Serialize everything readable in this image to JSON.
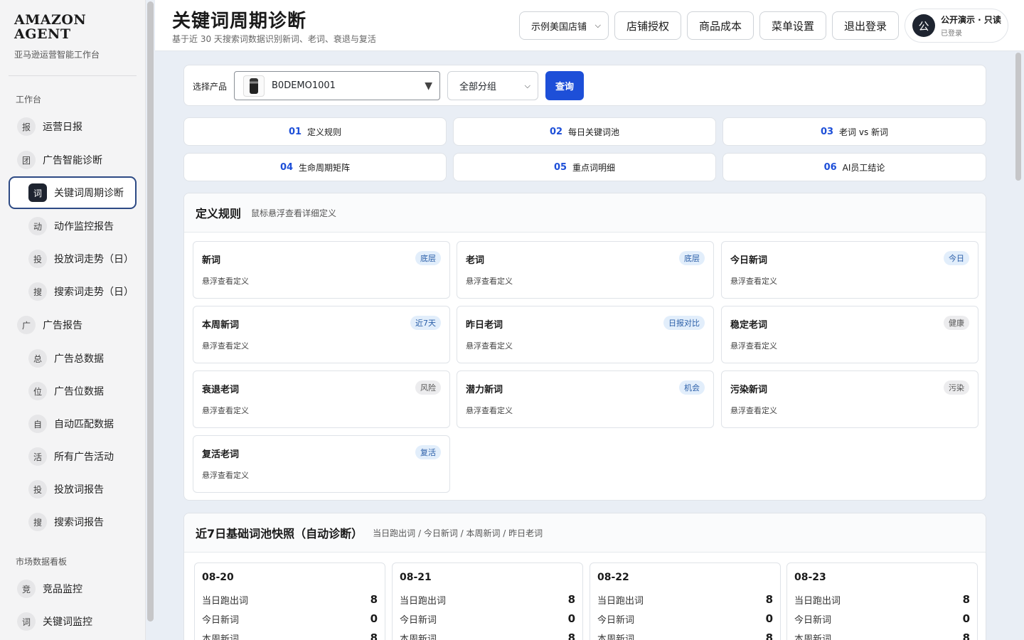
{
  "brand": {
    "name": "AMAZON AGENT",
    "subtitle": "亚马逊运营智能工作台"
  },
  "sidebar": {
    "sections": [
      {
        "label": "工作台"
      },
      {
        "label": "市场数据看板"
      }
    ],
    "items": [
      {
        "badge": "报",
        "label": "运营日报"
      },
      {
        "badge": "团",
        "label": "广告智能诊断"
      },
      {
        "badge": "词",
        "label": "关键词周期诊断"
      },
      {
        "badge": "动",
        "label": "动作监控报告"
      },
      {
        "badge": "投",
        "label": "投放词走势（日）"
      },
      {
        "badge": "搜",
        "label": "搜索词走势（日）"
      },
      {
        "badge": "广",
        "label": "广告报告"
      },
      {
        "badge": "总",
        "label": "广告总数据"
      },
      {
        "badge": "位",
        "label": "广告位数据"
      },
      {
        "badge": "自",
        "label": "自动匹配数据"
      },
      {
        "badge": "活",
        "label": "所有广告活动"
      },
      {
        "badge": "投",
        "label": "投放词报告"
      },
      {
        "badge": "搜",
        "label": "搜索词报告"
      },
      {
        "badge": "竞",
        "label": "竞品监控"
      },
      {
        "badge": "词",
        "label": "关键词监控"
      }
    ]
  },
  "header": {
    "title": "关键词周期诊断",
    "subtitle": "基于近 30 天搜索词数据识别新词、老词、衰退与复活",
    "store_select": "示例美国店铺",
    "buttons": [
      "店铺授权",
      "商品成本",
      "菜单设置",
      "退出登录"
    ],
    "user": {
      "avatar": "公",
      "name": "公开演示 · 只读",
      "status": "已登录"
    }
  },
  "query": {
    "label": "选择产品",
    "product": "B0DEMO1001",
    "group": "全部分组",
    "submit": "查询"
  },
  "tabs": [
    {
      "num": "01",
      "label": "定义规则"
    },
    {
      "num": "02",
      "label": "每日关键词池"
    },
    {
      "num": "03",
      "label": "老词 vs 新词"
    },
    {
      "num": "04",
      "label": "生命周期矩阵"
    },
    {
      "num": "05",
      "label": "重点词明细"
    },
    {
      "num": "06",
      "label": "AI员工结论"
    }
  ],
  "rules": {
    "title": "定义规则",
    "hint": "鼠标悬浮查看详细定义",
    "cards": [
      {
        "name": "新词",
        "tag": "底层",
        "tag_style": "blue",
        "desc": "悬浮查看定义"
      },
      {
        "name": "老词",
        "tag": "底层",
        "tag_style": "blue",
        "desc": "悬浮查看定义"
      },
      {
        "name": "今日新词",
        "tag": "今日",
        "tag_style": "blue",
        "desc": "悬浮查看定义"
      },
      {
        "name": "本周新词",
        "tag": "近7天",
        "tag_style": "blue",
        "desc": "悬浮查看定义"
      },
      {
        "name": "昨日老词",
        "tag": "日报对比",
        "tag_style": "blue",
        "desc": "悬浮查看定义"
      },
      {
        "name": "稳定老词",
        "tag": "健康",
        "tag_style": "gray",
        "desc": "悬浮查看定义"
      },
      {
        "name": "衰退老词",
        "tag": "风险",
        "tag_style": "gray",
        "desc": "悬浮查看定义"
      },
      {
        "name": "潜力新词",
        "tag": "机会",
        "tag_style": "blue",
        "desc": "悬浮查看定义"
      },
      {
        "name": "污染新词",
        "tag": "污染",
        "tag_style": "gray",
        "desc": "悬浮查看定义"
      },
      {
        "name": "复活老词",
        "tag": "复活",
        "tag_style": "blue",
        "desc": "悬浮查看定义"
      }
    ]
  },
  "snapshot": {
    "title": "近7日基础词池快照（自动诊断）",
    "hint": "当日跑出词 / 今日新词 / 本周新词 / 昨日老词",
    "days": [
      {
        "date": "08-20",
        "rows": [
          {
            "label": "当日跑出词",
            "value": "8"
          },
          {
            "label": "今日新词",
            "value": "0"
          },
          {
            "label": "本周新词",
            "value": "8"
          }
        ]
      },
      {
        "date": "08-21",
        "rows": [
          {
            "label": "当日跑出词",
            "value": "8"
          },
          {
            "label": "今日新词",
            "value": "0"
          },
          {
            "label": "本周新词",
            "value": "8"
          }
        ]
      },
      {
        "date": "08-22",
        "rows": [
          {
            "label": "当日跑出词",
            "value": "8"
          },
          {
            "label": "今日新词",
            "value": "0"
          },
          {
            "label": "本周新词",
            "value": "8"
          }
        ]
      },
      {
        "date": "08-23",
        "rows": [
          {
            "label": "当日跑出词",
            "value": "8"
          },
          {
            "label": "今日新词",
            "value": "0"
          },
          {
            "label": "本周新词",
            "value": "8"
          }
        ]
      }
    ]
  }
}
